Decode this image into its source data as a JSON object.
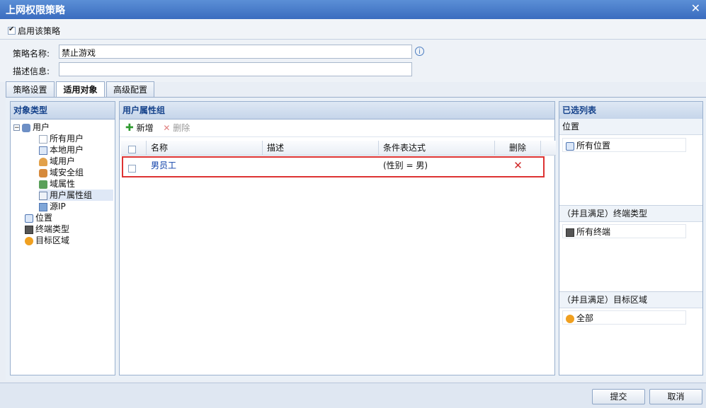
{
  "window": {
    "title": "上网权限策略",
    "close_glyph": "✕"
  },
  "enable": {
    "label": "启用该策略",
    "checked": true
  },
  "form": {
    "name_label": "策略名称:",
    "name_value": "禁止游戏",
    "desc_label": "描述信息:",
    "desc_value": ""
  },
  "tabs": [
    {
      "label": "策略设置"
    },
    {
      "label": "适用对象"
    },
    {
      "label": "高级配置"
    }
  ],
  "object_panel": {
    "title": "对象类型",
    "tree": {
      "root": "用户",
      "children": [
        "所有用户",
        "本地用户",
        "域用户",
        "域安全组",
        "域属性",
        "用户属性组",
        "源IP"
      ],
      "others": [
        "位置",
        "终端类型",
        "目标区域"
      ]
    }
  },
  "attr_panel": {
    "title": "用户属性组",
    "add_label": "新增",
    "delete_label": "删除",
    "columns": [
      "名称",
      "描述",
      "条件表达式",
      "删除"
    ],
    "rows": [
      {
        "name": "男员工",
        "desc": "",
        "expr": "(性别 = 男)",
        "delete": "✕"
      }
    ]
  },
  "selected_panel": {
    "title": "已选列表",
    "sections": [
      {
        "title": "位置",
        "item": "所有位置"
      },
      {
        "title": "（并且满足）终端类型",
        "item": "所有终端"
      },
      {
        "title": "（并且满足）目标区域",
        "item": "全部"
      }
    ]
  },
  "footer": {
    "submit": "提交",
    "cancel": "取消"
  },
  "colors": {
    "title_bar": "#3a6cbf",
    "panel_header_text": "#15428b",
    "highlight_border": "#dd3333",
    "link": "#0b3ea8"
  }
}
